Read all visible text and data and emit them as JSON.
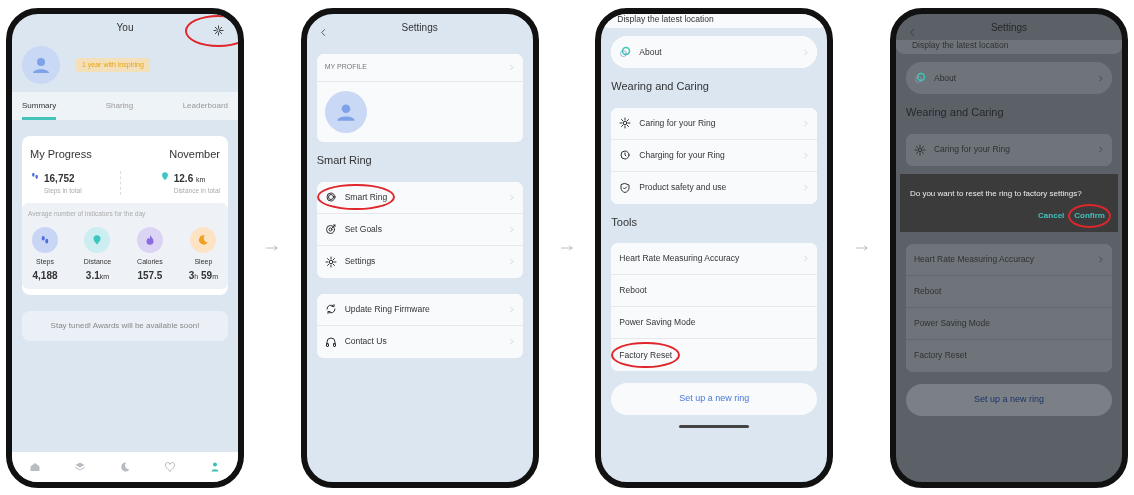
{
  "screens": [
    {
      "kind": "profile",
      "title": "You",
      "settings_highlighted": true,
      "badge": "1 year with inspiring",
      "tabs": [
        {
          "label": "Summary",
          "selected": true
        },
        {
          "label": "Sharing",
          "selected": false
        },
        {
          "label": "Leaderboard",
          "selected": false
        }
      ],
      "progress": {
        "title": "My Progress",
        "month": "November",
        "totals": [
          {
            "number": "16,752",
            "caption": "Steps in total"
          },
          {
            "number": "12.6",
            "unit": "km",
            "caption": "Distance in total"
          }
        ],
        "average_label": "Average number of indicators for the day",
        "indicators": [
          {
            "label": "Steps",
            "parts": [
              {
                "number": "4,188"
              }
            ]
          },
          {
            "label": "Distance",
            "parts": [
              {
                "number": "3.1",
                "unit": "km"
              }
            ]
          },
          {
            "label": "Calories",
            "parts": [
              {
                "number": "157.5"
              }
            ]
          },
          {
            "label": "Sleep",
            "parts": [
              {
                "number": "3",
                "unit": "h"
              },
              {
                "number": "59",
                "unit": "m"
              }
            ]
          }
        ]
      },
      "notice": "Stay tuned! Awards will be available soon!",
      "nav": [
        {
          "selected": false
        },
        {
          "selected": false
        },
        {
          "selected": false
        },
        {
          "selected": false
        },
        {
          "selected": true
        }
      ]
    },
    {
      "kind": "settings",
      "dimmed": false,
      "header": {
        "title": "Settings",
        "back": true
      },
      "blocks": [
        {
          "kind": "profile_card",
          "label": "MY PROFILE"
        },
        {
          "kind": "heading",
          "text": "Smart Ring"
        },
        {
          "kind": "card",
          "items": [
            {
              "label": "Smart Ring",
              "icon": true,
              "chevron": true,
              "highlighted": true
            },
            {
              "label": "Set Goals",
              "icon": true,
              "chevron": true,
              "highlighted": false
            },
            {
              "label": "Settings",
              "icon": true,
              "chevron": true,
              "highlighted": false
            }
          ]
        },
        {
          "kind": "card",
          "items": [
            {
              "label": "Update Ring Firmware",
              "icon": true,
              "chevron": true,
              "highlighted": false
            },
            {
              "label": "Contact Us",
              "icon": true,
              "chevron": true,
              "highlighted": false
            }
          ]
        }
      ]
    },
    {
      "kind": "settings",
      "dimmed": false,
      "blocks": [
        {
          "kind": "cut_text",
          "text": "Display the latest location"
        },
        {
          "kind": "card",
          "round": true,
          "items": [
            {
              "label": "About",
              "icon": true,
              "chevron": true,
              "highlighted": false
            }
          ]
        },
        {
          "kind": "heading",
          "text": "Wearing and Caring"
        },
        {
          "kind": "card",
          "items": [
            {
              "label": "Caring for your Ring",
              "icon": true,
              "chevron": true,
              "highlighted": false
            },
            {
              "label": "Charging for your Ring",
              "icon": true,
              "chevron": true,
              "highlighted": false
            },
            {
              "label": "Product safety and use",
              "icon": true,
              "chevron": true,
              "highlighted": false
            }
          ]
        },
        {
          "kind": "heading",
          "text": "Tools"
        },
        {
          "kind": "card",
          "items": [
            {
              "label": "Heart Rate Measuring Accuracy",
              "icon": false,
              "chevron": true,
              "highlighted": false
            },
            {
              "label": "Reboot",
              "icon": false,
              "chevron": false,
              "highlighted": false
            },
            {
              "label": "Power Saving Mode",
              "icon": false,
              "chevron": false,
              "highlighted": false
            },
            {
              "label": "Factory Reset",
              "icon": false,
              "chevron": false,
              "highlighted": true
            }
          ]
        },
        {
          "kind": "button",
          "text": "Set up a new ring"
        },
        {
          "kind": "home_bar"
        }
      ]
    },
    {
      "kind": "settings",
      "dimmed": true,
      "header": {
        "title": "Settings",
        "back": true
      },
      "blocks": [
        {
          "kind": "cut_text",
          "text": "Display the latest location"
        },
        {
          "kind": "card",
          "round": true,
          "items": [
            {
              "label": "About",
              "icon": true,
              "chevron": true,
              "highlighted": false
            }
          ]
        },
        {
          "kind": "heading",
          "text": "Wearing and Caring"
        },
        {
          "kind": "card",
          "items": [
            {
              "label": "Caring for your Ring",
              "icon": true,
              "chevron": true,
              "highlighted": false
            }
          ]
        },
        {
          "kind": "dialog",
          "message": "Do you want to reset the ring to factory settings?",
          "actions": [
            {
              "label": "Cancel",
              "highlighted": false
            },
            {
              "label": "Confirm",
              "highlighted": true
            }
          ]
        },
        {
          "kind": "card",
          "items": [
            {
              "label": "Heart Rate Measuring Accuracy",
              "icon": false,
              "chevron": true,
              "highlighted": false
            },
            {
              "label": "Reboot",
              "icon": false,
              "chevron": false,
              "highlighted": false
            },
            {
              "label": "Power Saving Mode",
              "icon": false,
              "chevron": false,
              "highlighted": false
            },
            {
              "label": "Factory Reset",
              "icon": false,
              "chevron": false,
              "highlighted": false
            }
          ]
        },
        {
          "kind": "button",
          "text": "Set up a new ring"
        }
      ]
    }
  ]
}
